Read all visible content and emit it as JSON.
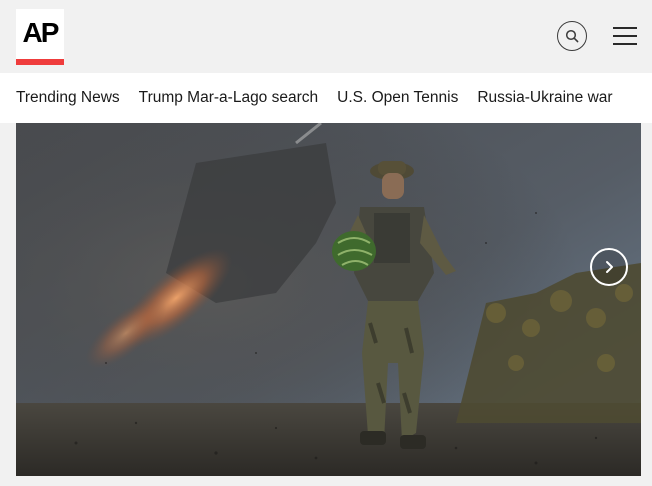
{
  "brand": {
    "logo_text": "AP",
    "accent_color": "#ef3c3c"
  },
  "header": {
    "search_icon": "search-icon",
    "menu_icon": "hamburger-menu-icon"
  },
  "nav": {
    "items": [
      {
        "label": "Trending News"
      },
      {
        "label": "Trump Mar-a-Lago search"
      },
      {
        "label": "U.S. Open Tennis"
      },
      {
        "label": "Russia-Ukraine war"
      }
    ]
  },
  "hero": {
    "next_icon": "chevron-right-icon"
  }
}
